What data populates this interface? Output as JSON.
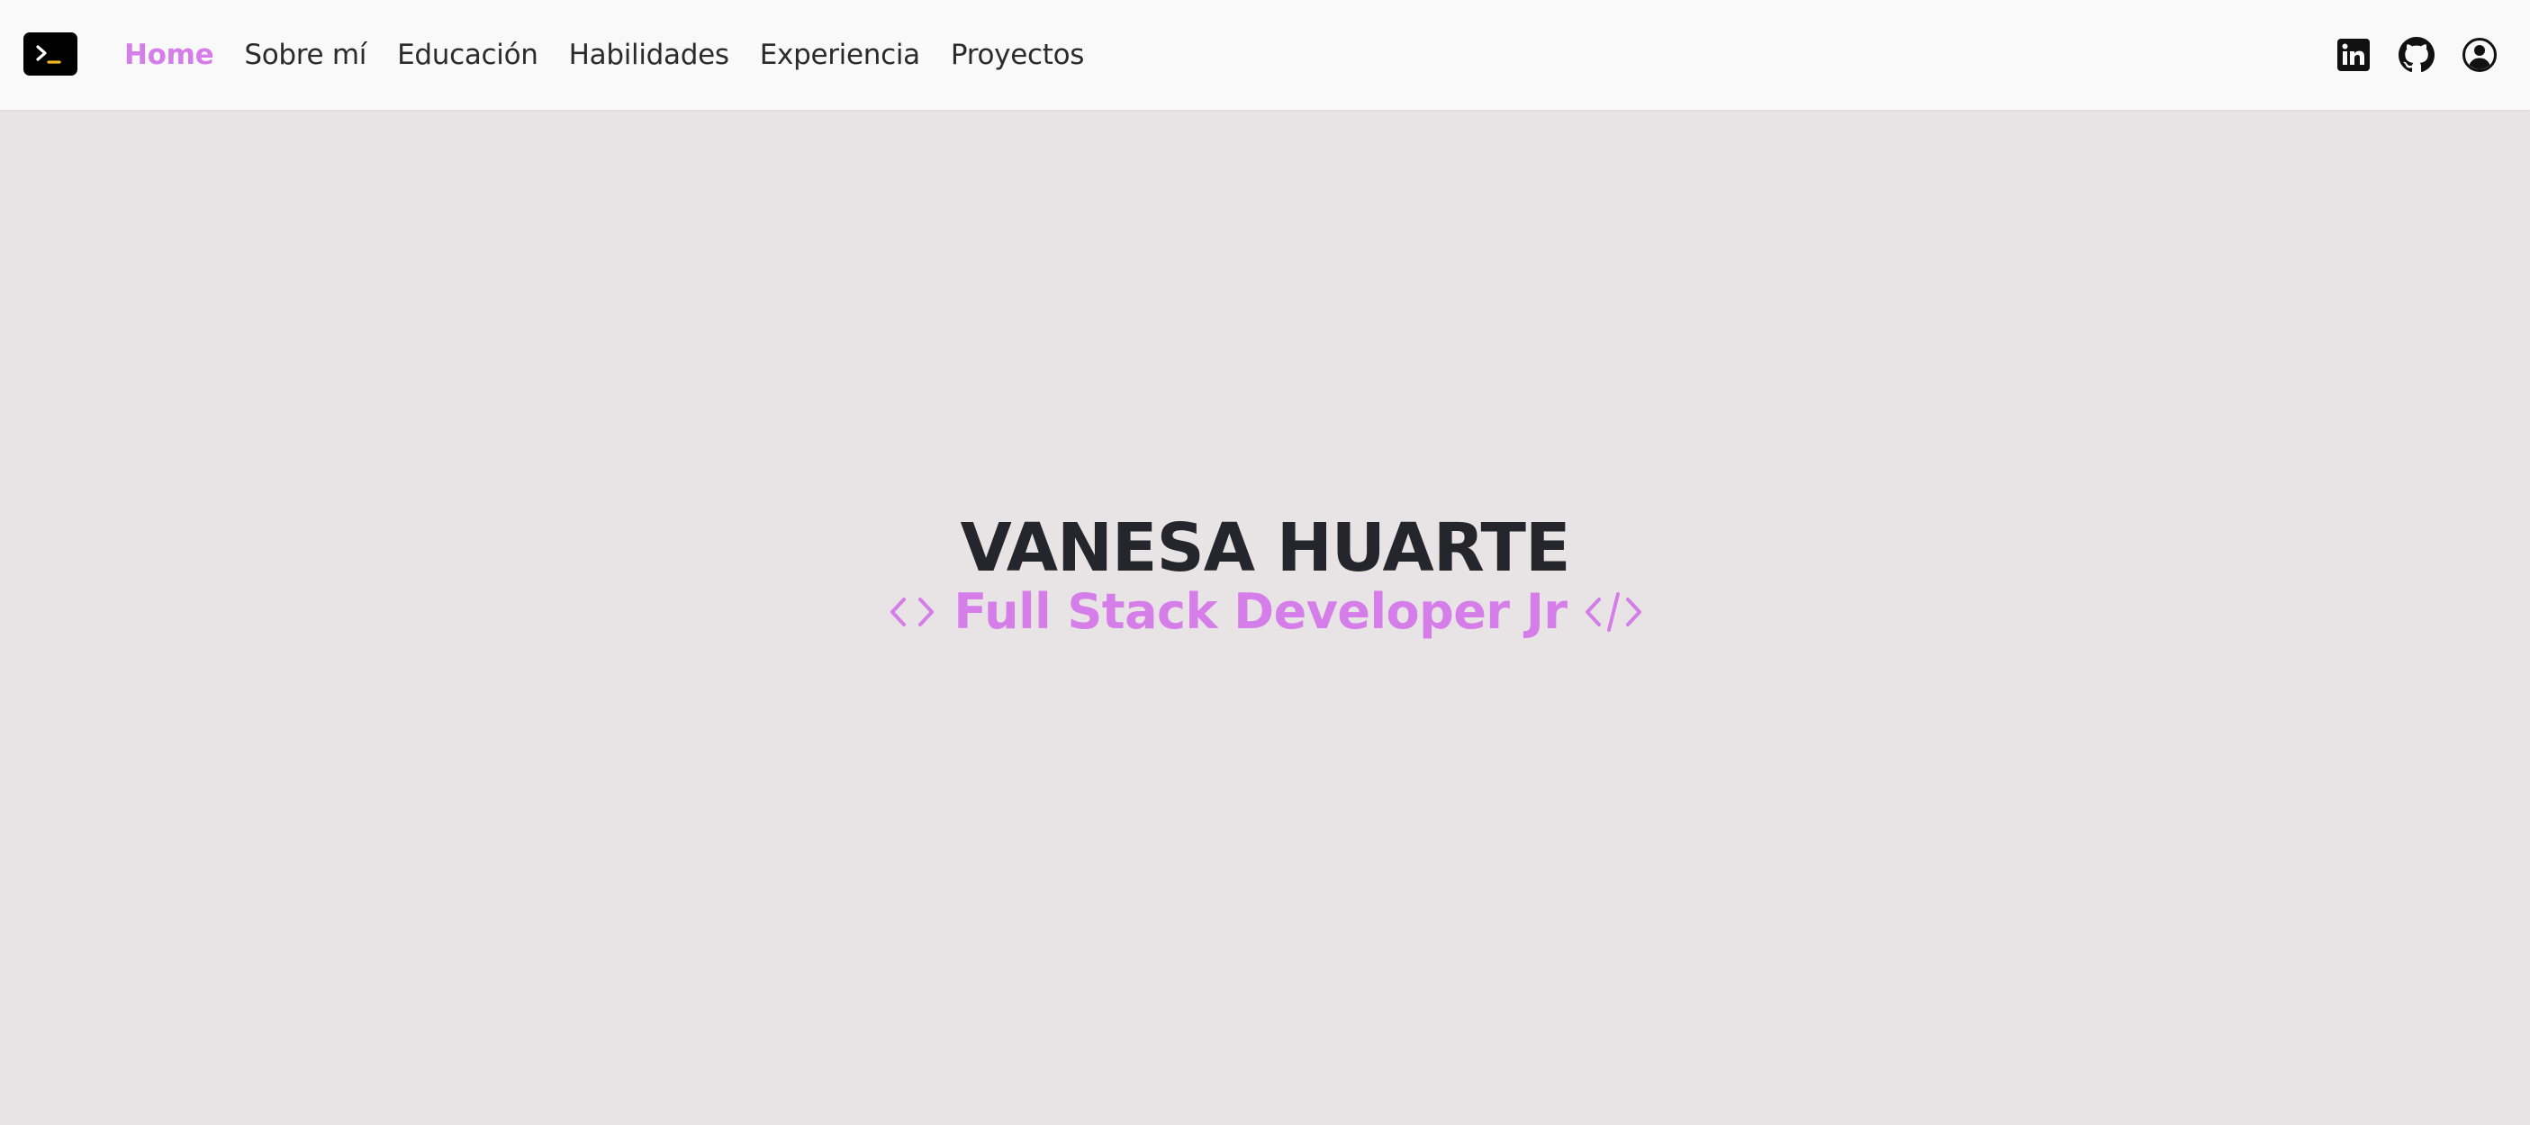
{
  "navbar": {
    "logo_icon": "terminal-icon",
    "links": [
      {
        "label": "Home",
        "active": true
      },
      {
        "label": "Sobre mí",
        "active": false
      },
      {
        "label": "Educación",
        "active": false
      },
      {
        "label": "Habilidades",
        "active": false
      },
      {
        "label": "Experiencia",
        "active": false
      },
      {
        "label": "Proyectos",
        "active": false
      }
    ],
    "icons": [
      "linkedin-icon",
      "github-icon",
      "user-circle-icon"
    ]
  },
  "hero": {
    "name": "VANESA HUARTE",
    "subtitle": "Full Stack Developer Jr",
    "left_icon": "code-brackets-icon",
    "right_icon": "code-slash-icon"
  },
  "colors": {
    "accent": "#d57de8",
    "background": "#e8e4e5",
    "navbar_bg": "#f9f9f9",
    "text_dark": "#24262b"
  }
}
